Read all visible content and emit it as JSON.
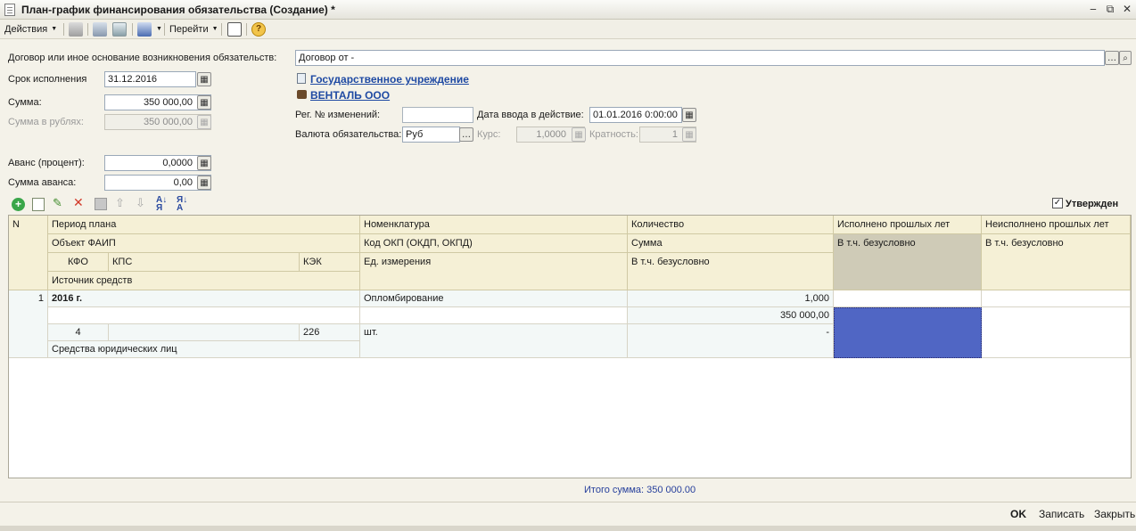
{
  "window": {
    "title": "План-график финансирования обязательства (Создание) *"
  },
  "toolbar": {
    "actions_label": "Действия",
    "goto_label": "Перейти"
  },
  "form": {
    "contract_label": "Договор или иное основание возникновения обязательств:",
    "contract_value": "Договор  от -",
    "deadline_label": "Срок исполнения",
    "deadline_value": "31.12.2016",
    "sum_label": "Сумма:",
    "sum_value": "350 000,00",
    "sum_rub_label": "Сумма в рублях:",
    "sum_rub_value": "350 000,00",
    "advance_pct_label": "Аванс (процент):",
    "advance_pct_value": "0,0000",
    "advance_sum_label": "Сумма аванса:",
    "advance_sum_value": "0,00",
    "org_link": "Государственное учреждение",
    "contractor_link": "ВЕНТАЛЬ ООО",
    "reg_label": "Рег. № изменений:",
    "reg_value": "",
    "date_label": "Дата ввода в действие:",
    "date_value": "01.01.2016  0:00:00",
    "currency_label": "Валюта обязательства:",
    "currency_value": "Руб",
    "rate_label": "Курс:",
    "rate_value": "1,0000",
    "mult_label": "Кратность:",
    "mult_value": "1",
    "approved_label": "Утвержден",
    "approved_checked": true
  },
  "table": {
    "headers": {
      "n": "N",
      "period": "Период плана",
      "faip": "Объект ФАИП",
      "kfo": "КФО",
      "kps": "КПС",
      "kek": "КЭК",
      "source": "Источник средств",
      "nomenclature": "Номенклатура",
      "okp": "Код ОКП (ОКДП,  ОКПД)",
      "unit": "Ед. измерения",
      "qty": "Количество",
      "summa": "Сумма",
      "uncond": "В т.ч. безусловно",
      "done_prev": "Исполнено прошлых лет",
      "done_uncond": "В т.ч. безусловно",
      "notdone_prev": "Неисполнено прошлых лет",
      "notdone_uncond": "В т.ч. безусловно"
    },
    "rows": [
      {
        "n": "1",
        "period": "2016 г.",
        "faip": "",
        "kfo": "4",
        "kps": "",
        "kek": "226",
        "source": "Средства юридических лиц",
        "nomenclature": "Опломбирование",
        "okp": "",
        "unit": "шт.",
        "qty": "1,000",
        "summa": "350 000,00",
        "uncond": "-"
      }
    ]
  },
  "footer": {
    "total": "Итого сумма: 350 000.00",
    "ok": "OK",
    "save": "Записать",
    "close": "Закрыть"
  },
  "colors": {
    "selected_cell": "#5066c4",
    "link": "#1f4aa3",
    "header_bg": "#f5f0d6"
  }
}
